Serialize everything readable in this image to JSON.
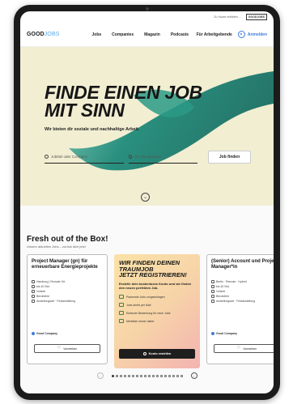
{
  "utility": {
    "link": "Zu Hause entfalten ...",
    "badge": "GOODJOBS"
  },
  "header": {
    "logo_good": "GOOD",
    "logo_jobs": "JOBS",
    "nav": [
      "Jobs",
      "Companies",
      "Magazin",
      "Podcasts"
    ],
    "employers": "Für Arbeitgebende",
    "login": "Anmelden"
  },
  "hero": {
    "title_line1": "FINDE EINEN JOB",
    "title_line2": "MIT SINN",
    "subtitle": "Wir bieten dir soziale und nachhaltige Arbeit.",
    "keyword_placeholder": "Jobtitel oder Company",
    "location_placeholder": "Ort, Bundesland",
    "search_button": "Job finden",
    "scroll_glyph": "⌄"
  },
  "listings": {
    "title": "Fresh out of the Box!",
    "subtitle": "Unsere aktuellen Jobs – zurück dich jetzt",
    "cards": [
      {
        "title": "Project Manager (gn) für erneuerbare Energieprojekte",
        "meta": [
          "Hamburg | Remote Ort",
          "bis 40 Std.",
          "Vollzeit",
          "Berufsfeld",
          "Anstellungsart · Festanstellung"
        ],
        "company": "Good Company",
        "remember": "Vormerken"
      },
      {
        "title": "(Senior) Account und Projekt Manager*in",
        "meta": [
          "Berlin · Remote · Hybrid",
          "bis 40 Std.",
          "Vollzeit",
          "Berufsfeld",
          "Anstellungsart · Festanstellung"
        ],
        "company": "Good Company",
        "remember": "Vormerken"
      }
    ],
    "promo": {
      "title_line1": "WIR FINDEN DEINEN",
      "title_line2": "TRAUMJOB",
      "title_line3": "JETZT REGISTRIEREN!",
      "text": "Erstelle dein kostenloses Konto und wir finden den neuen perfekten Job.",
      "benefits": [
        "Passende Jobs vorgeschlagen",
        "Jobs direkt per Mail",
        "Einfache Bewerbung für neue Jobs",
        "Merkliste immer dabei"
      ],
      "cta": "Konto erstellen"
    },
    "pager": {
      "prev": "‹",
      "next": "›"
    }
  },
  "colors": {
    "hero_bg": "#f1eed2",
    "ribbon": "#1f8a7a",
    "accent": "#3d7bd9",
    "logo_jobs": "#5aa9e6"
  }
}
